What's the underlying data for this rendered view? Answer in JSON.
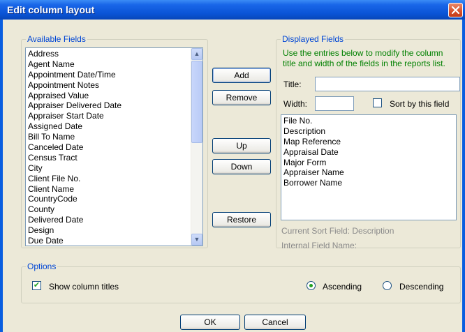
{
  "window": {
    "title": "Edit column layout"
  },
  "available": {
    "legend": "Available Fields",
    "items": [
      "Address",
      "Agent Name",
      "Appointment Date/Time",
      "Appointment Notes",
      "Appraised Value",
      "Appraiser Delivered Date",
      "Appraiser Start Date",
      "Assigned Date",
      "Bill To Name",
      "Canceled Date",
      "Census Tract",
      "City",
      "Client File No.",
      "Client Name",
      "CountryCode",
      "County",
      "Delivered Date",
      "Design",
      "Due Date"
    ]
  },
  "buttons": {
    "add": "Add",
    "remove": "Remove",
    "up": "Up",
    "down": "Down",
    "restore": "Restore",
    "ok": "OK",
    "cancel": "Cancel"
  },
  "displayed": {
    "legend": "Displayed Fields",
    "hint_line1": "Use the entries below to modify the column",
    "hint_line2": "title and width of the fields in the reports list.",
    "title_label": "Title:",
    "title_value": "",
    "width_label": "Width:",
    "width_value": "",
    "sort_label": "Sort by this field",
    "sort_checked": false,
    "items": [
      "File No.",
      "Description",
      "Map Reference",
      "Appraisal Date",
      "Major Form",
      "Appraiser Name",
      "Borrower Name"
    ],
    "current_sort": "Current Sort Field: Description",
    "internal_name": "Internal Field Name:"
  },
  "options": {
    "legend": "Options",
    "show_titles_label": "Show column titles",
    "show_titles_checked": true,
    "ascending_label": "Ascending",
    "descending_label": "Descending",
    "selected_order": "ascending"
  },
  "colors": {
    "title_bar": "#0a54d6",
    "legend_text": "#0046d5",
    "hint_text": "#008000",
    "close_button": "#d8502b"
  },
  "icons": {
    "close": "close-icon",
    "check": "checkmark-icon",
    "scroll_up": "scroll-up-arrow-icon",
    "scroll_down": "scroll-down-arrow-icon"
  }
}
